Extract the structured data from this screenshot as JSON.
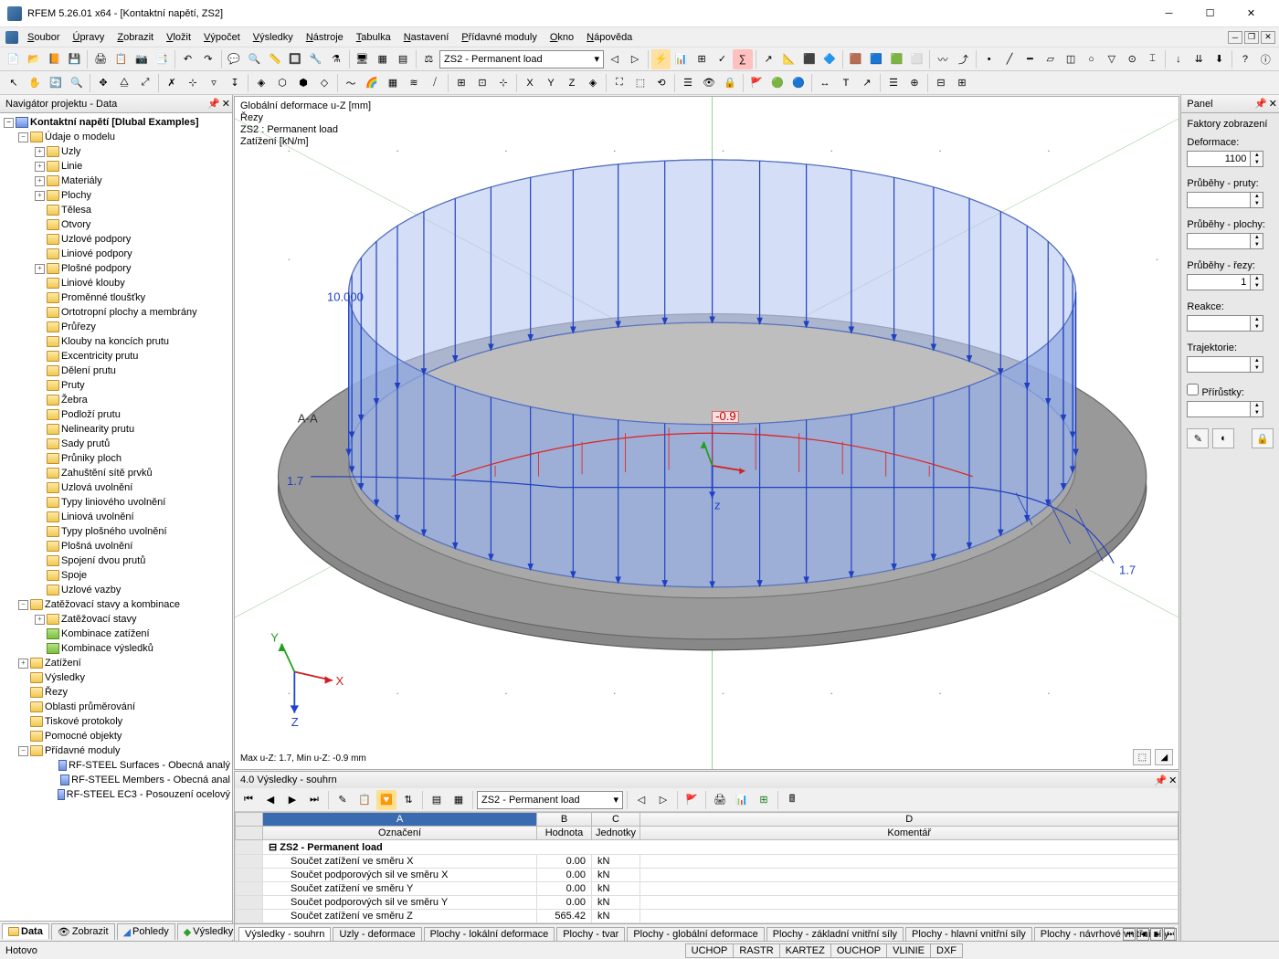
{
  "title": "RFEM 5.26.01 x64 - [Kontaktní napětí, ZS2]",
  "menus": [
    "Soubor",
    "Úpravy",
    "Zobrazit",
    "Vložit",
    "Výpočet",
    "Výsledky",
    "Nástroje",
    "Tabulka",
    "Nastavení",
    "Přídavné moduly",
    "Okno",
    "Nápověda"
  ],
  "combo1": "ZS2 - Permanent load",
  "navigator": {
    "title": "Navigátor projektu - Data",
    "root": "Kontaktní napětí [Dlubal Examples]",
    "group1": "Údaje o modelu",
    "items1": [
      "Uzly",
      "Linie",
      "Materiály",
      "Plochy",
      "Tělesa",
      "Otvory",
      "Uzlové podpory",
      "Liniové podpory",
      "Plošné podpory",
      "Liniové klouby",
      "Proměnné tloušťky",
      "Ortotropní plochy a membrány",
      "Průřezy",
      "Klouby na koncích prutu",
      "Excentricity prutu",
      "Dělení prutu",
      "Pruty",
      "Žebra",
      "Podloží prutu",
      "Nelinearity prutu",
      "Sady prutů",
      "Průniky ploch",
      "Zahuštění sítě prvků",
      "Uzlová uvolnění",
      "Typy liniového uvolnění",
      "Liniová uvolnění",
      "Typy plošného uvolnění",
      "Plošná uvolnění",
      "Spojení dvou prutů",
      "Spoje",
      "Uzlové vazby"
    ],
    "group2": "Zatěžovací stavy a kombinace",
    "items2": [
      "Zatěžovací stavy",
      "Kombinace zatížení",
      "Kombinace výsledků"
    ],
    "rest": [
      "Zatížení",
      "Výsledky",
      "Řezy",
      "Oblasti průměrování",
      "Tiskové protokoly",
      "Pomocné objekty",
      "Přídavné moduly"
    ],
    "modules": [
      "RF-STEEL Surfaces - Obecná analý",
      "RF-STEEL Members - Obecná anal",
      "RF-STEEL EC3 - Posouzení ocelový"
    ]
  },
  "navtabs": [
    "Data",
    "Zobrazit",
    "Pohledy",
    "Výsledky"
  ],
  "view": {
    "l1": "Globální deformace u-Z [mm]",
    "l2": "Řezy",
    "l3": "ZS2 : Permanent load",
    "l4": "Zatížení [kN/m]",
    "bottom": "Max u-Z: 1.7, Min u-Z: -0.9 mm",
    "load_value": "10.000",
    "def_neg": "-0.9",
    "def_pos": "1.7",
    "section_label": "A-A"
  },
  "bottompanel": {
    "title": "4.0 Výsledky - souhrn",
    "combo": "ZS2 - Permanent load",
    "cols": [
      "Označení",
      "Hodnota",
      "Jednotky",
      "Komentář"
    ],
    "colabcd": [
      "A",
      "B",
      "C",
      "D"
    ],
    "grouprow": "ZS2 - Permanent load",
    "rows": [
      {
        "n": "Součet zatížení ve směru X",
        "v": "0.00",
        "u": "kN"
      },
      {
        "n": "Součet podporových sil ve směru X",
        "v": "0.00",
        "u": "kN"
      },
      {
        "n": "Součet zatížení ve směru Y",
        "v": "0.00",
        "u": "kN"
      },
      {
        "n": "Součet podporových sil ve směru Y",
        "v": "0.00",
        "u": "kN"
      },
      {
        "n": "Součet zatížení ve směru Z",
        "v": "565.42",
        "u": "kN"
      }
    ]
  },
  "bottomtabs": [
    "Výsledky - souhrn",
    "Uzly - deformace",
    "Plochy - lokální deformace",
    "Plochy - tvar",
    "Plochy - globální deformace",
    "Plochy - základní vnitřní síly",
    "Plochy - hlavní vnitřní síly",
    "Plochy - návrhové vnitřní síly"
  ],
  "panel": {
    "title": "Panel",
    "section": "Faktory zobrazení",
    "labels": [
      "Deformace:",
      "Průběhy - pruty:",
      "Průběhy - plochy:",
      "Průběhy - řezy:",
      "Reakce:",
      "Trajektorie:",
      "Přírůstky:"
    ],
    "values": [
      "1100",
      "",
      "",
      "1",
      "",
      "",
      ""
    ]
  },
  "status": "Hotovo",
  "status_items": [
    "UCHOP",
    "RASTR",
    "KARTEZ",
    "OUCHOP",
    "VLINIE",
    "DXF"
  ]
}
